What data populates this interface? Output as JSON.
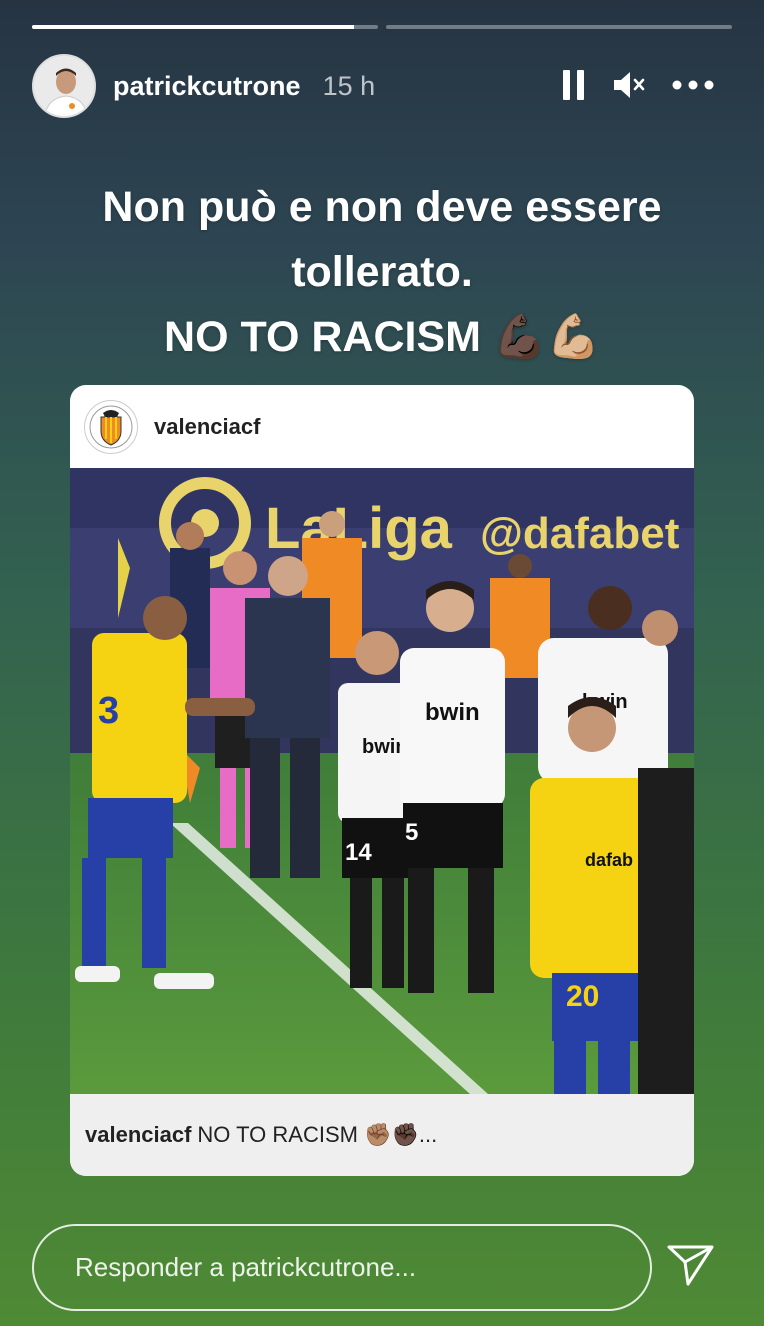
{
  "story": {
    "progress": [
      1.0,
      0.0
    ],
    "progress_current_fraction": 0.93
  },
  "header": {
    "username": "patrickcutrone",
    "time": "15 h",
    "icons": [
      "pause-icon",
      "muted-speaker-icon",
      "more-icon"
    ]
  },
  "caption": {
    "line1": "Non può e non deve essere",
    "line2": "tollerato.",
    "line3": "NO TO RACISM 💪🏿💪🏼"
  },
  "post": {
    "username": "valenciacf",
    "image_alt": "LaLiga Valencia vs Cádiz players",
    "caption_user": "valenciacf",
    "caption_text": "NO TO RACISM ✊🏽✊🏿...",
    "banner": {
      "laliga": "LaLiga",
      "sponsor": "@dafabet",
      "shirt_sponsor": "bwin",
      "shirt_sponsor_cadiz": "dafab",
      "numbers": [
        "3",
        "14",
        "5",
        "20"
      ]
    }
  },
  "reply": {
    "placeholder": "Responder a patrickcutrone..."
  },
  "colors": {
    "accent_white": "#ffffff",
    "valencia_orange": "#f08a24",
    "cadiz_yellow": "#f5d312",
    "laliga_banner": "#3b3f73"
  }
}
